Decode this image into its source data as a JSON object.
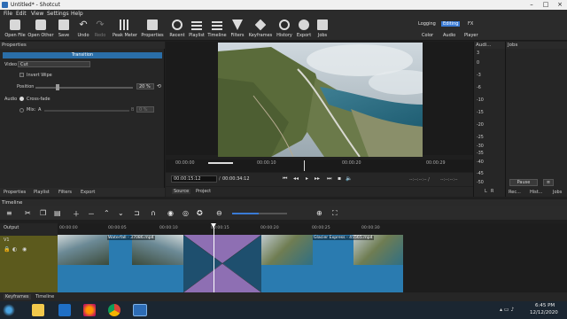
{
  "window": {
    "title": "Untitled* - Shotcut"
  },
  "menu": [
    "File",
    "Edit",
    "View",
    "Settings",
    "Help"
  ],
  "toolbar": [
    "Open File",
    "Open Other",
    "Save",
    "Undo",
    "Redo",
    "Peak Meter",
    "Properties",
    "Recent",
    "Playlist",
    "Timeline",
    "Filters",
    "Keyframes",
    "History",
    "Export",
    "Jobs"
  ],
  "layouts": {
    "top": [
      "Logging",
      "Editing",
      "FX"
    ],
    "bottom": [
      "Color",
      "Audio",
      "Player"
    ]
  },
  "properties": {
    "title": "Properties",
    "header": "Transition",
    "video_label": "Video",
    "video_value": "Cut",
    "invert_wipe": "Invert Wipe",
    "position_label": "Position",
    "position_value": "20 %",
    "audio_label": "Audio",
    "cross_fade": "Cross-fade",
    "mix_label": "Mix:",
    "mix_a": "A",
    "mix_b": "B",
    "mix_value": "0 %",
    "tabs": [
      "Properties",
      "Playlist",
      "Filters",
      "Export"
    ]
  },
  "viewer": {
    "ruler_ticks": [
      "00:00:00",
      "00:00:10",
      "00:00:20",
      "00:00:29"
    ],
    "current_time": "00:00:15:12",
    "duration": "00:00:34:12",
    "in_out": "--:--:--:-- /",
    "out_point": "--:--:--:--",
    "tabs": [
      "Source",
      "Project"
    ]
  },
  "audio_meter": {
    "title": "Audi...",
    "scale": [
      "3",
      "0",
      "-3",
      "-6",
      "-10",
      "-15",
      "-20",
      "-25",
      "-30",
      "-35",
      "-40",
      "-45",
      "-50"
    ],
    "channels": [
      "L",
      "R"
    ]
  },
  "jobs": {
    "title": "Jobs",
    "pause": "Pause",
    "tabs": [
      "Rec...",
      "Hist...",
      "Jobs"
    ]
  },
  "timeline": {
    "title": "Timeline",
    "output": "Output",
    "track": "V1",
    "ruler": [
      "00:00:00",
      "00:00:05",
      "00:00:10",
      "00:00:15",
      "00:00:20",
      "00:00:25",
      "00:00:30"
    ],
    "clips": [
      "Waterfall - 37086.mp4",
      "Glacier Express - 45565.mp4"
    ]
  },
  "bottom_tabs": [
    "Keyframes",
    "Timeline"
  ],
  "taskbar": {
    "time": "6:45 PM",
    "date": "12/12/2020"
  },
  "colors": {
    "accent": "#3a7bd5",
    "transition": "#8e6fb3",
    "clip": "#2a7bb0",
    "track_head": "#5c5a1d"
  }
}
